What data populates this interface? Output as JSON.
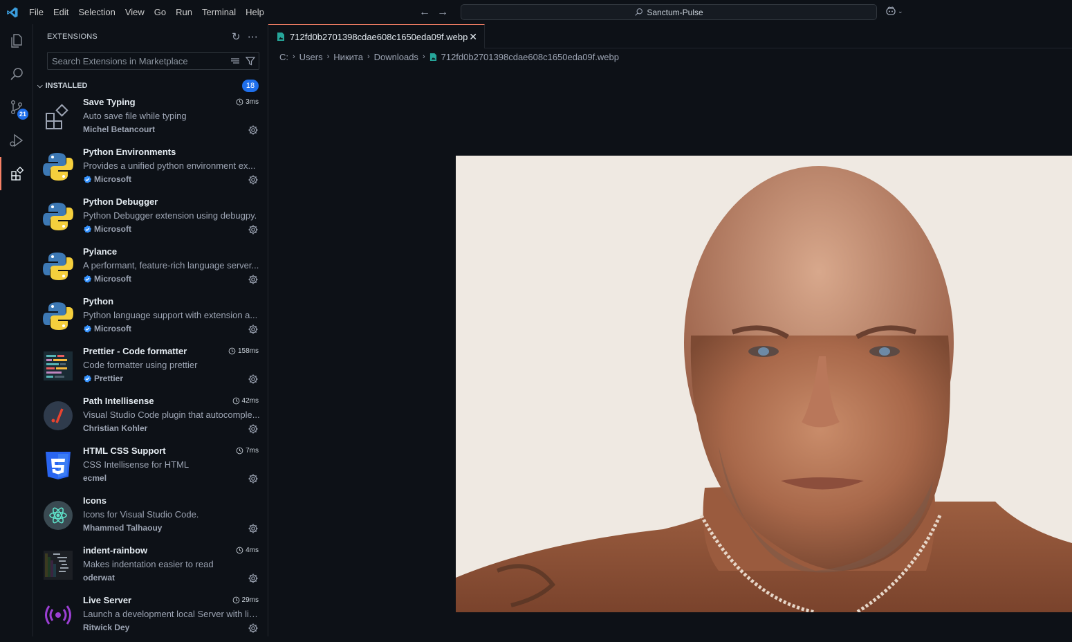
{
  "titlebar": {
    "menu": [
      "File",
      "Edit",
      "Selection",
      "View",
      "Go",
      "Run",
      "Terminal",
      "Help"
    ],
    "command_center": "Sanctum-Pulse"
  },
  "activitybar": {
    "source_control_badge": "21"
  },
  "sidebar": {
    "title": "EXTENSIONS",
    "search_placeholder": "Search Extensions in Marketplace",
    "section_title": "INSTALLED",
    "installed_count": "18",
    "extensions": [
      {
        "name": "Save Typing",
        "description": "Auto save file while typing",
        "publisher": "Michel Betancourt",
        "time": "3ms",
        "verified": false,
        "icon": "extension-puzzle-icon"
      },
      {
        "name": "Python Environments",
        "description": "Provides a unified python environment ex...",
        "publisher": "Microsoft",
        "time": "",
        "verified": true,
        "icon": "python-icon"
      },
      {
        "name": "Python Debugger",
        "description": "Python Debugger extension using debugpy.",
        "publisher": "Microsoft",
        "time": "",
        "verified": true,
        "icon": "python-icon"
      },
      {
        "name": "Pylance",
        "description": "A performant, feature-rich language server...",
        "publisher": "Microsoft",
        "time": "",
        "verified": true,
        "icon": "python-icon"
      },
      {
        "name": "Python",
        "description": "Python language support with extension a...",
        "publisher": "Microsoft",
        "time": "",
        "verified": true,
        "icon": "python-icon"
      },
      {
        "name": "Prettier - Code formatter",
        "description": "Code formatter using prettier",
        "publisher": "Prettier",
        "time": "158ms",
        "verified": true,
        "icon": "prettier-icon"
      },
      {
        "name": "Path Intellisense",
        "description": "Visual Studio Code plugin that autocomple...",
        "publisher": "Christian Kohler",
        "time": "42ms",
        "verified": false,
        "icon": "path-intellisense-icon"
      },
      {
        "name": "HTML CSS Support",
        "description": "CSS Intellisense for HTML",
        "publisher": "ecmel",
        "time": "7ms",
        "verified": false,
        "icon": "css3-icon"
      },
      {
        "name": "Icons",
        "description": "Icons for Visual Studio Code.",
        "publisher": "Mhammed Talhaouy",
        "time": "",
        "verified": false,
        "icon": "react-atom-icon"
      },
      {
        "name": "indent-rainbow",
        "description": "Makes indentation easier to read",
        "publisher": "oderwat",
        "time": "4ms",
        "verified": false,
        "icon": "indent-rainbow-icon"
      },
      {
        "name": "Live Server",
        "description": "Launch a development local Server with liv...",
        "publisher": "Ritwick Dey",
        "time": "29ms",
        "verified": false,
        "icon": "live-server-icon"
      }
    ]
  },
  "editor": {
    "tab_label": "712fd0b2701398cdae608c1650eda09f.webp",
    "breadcrumb": [
      "C:",
      "Users",
      "Никита",
      "Downloads",
      "712fd0b2701398cdae608c1650eda09f.webp"
    ]
  },
  "colors": {
    "accent": "#f78166",
    "badge": "#1f6feb",
    "background": "#0d1117"
  }
}
